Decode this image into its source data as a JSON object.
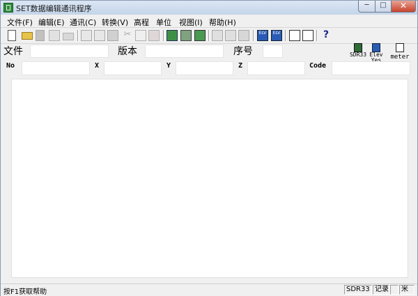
{
  "window": {
    "title": "SET数据编辑通讯程序"
  },
  "menu": [
    "文件(F)",
    "编辑(E)",
    "通讯(C)",
    "转换(V)",
    "高程",
    "单位",
    "视图(I)",
    "帮助(H)"
  ],
  "toolbar": {
    "icons": [
      "new-file-icon",
      "open-folder-icon",
      "save-icon",
      "print-preview-icon",
      "print-icon",
      "cut-column-icon",
      "paste-column-icon",
      "copy-table-icon",
      "scissors-icon",
      "copy-icon",
      "paste-icon",
      "transfer-icon",
      "convert-icon",
      "export-icon",
      "insert-row-icon",
      "delete-row-icon",
      "clear-icon",
      "elevation-send-icon",
      "elevation-receive-icon",
      "calculator-icon",
      "unit-icon",
      "help-icon"
    ]
  },
  "fields": {
    "file_label": "文件",
    "version_label": "版本",
    "serial_label": "序号",
    "no_label": "No",
    "x_label": "X",
    "y_label": "Y",
    "z_label": "Z",
    "code_label": "Code"
  },
  "side": {
    "model_label": "SDR33",
    "elev_label": "Elev",
    "elev_state": "Yes",
    "unit_label": "meter"
  },
  "status": {
    "help_text": "按F1获取帮助",
    "model": "SDR33",
    "record": "记录",
    "unit": "米"
  },
  "colors": {
    "title_gradient_top": "#dbe6f4",
    "close_button": "#c7432c",
    "app_icon": "#2f8a3a"
  }
}
